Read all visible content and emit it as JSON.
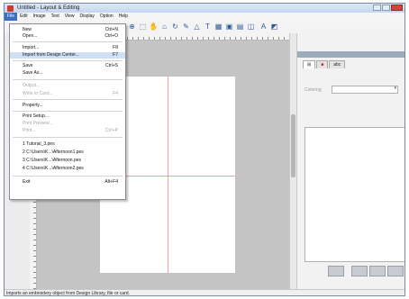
{
  "window": {
    "title": "Untitled - Layout & Editing"
  },
  "menubar": {
    "items": [
      "File",
      "Edit",
      "Image",
      "Text",
      "View",
      "Display",
      "Option",
      "Help"
    ]
  },
  "file_menu": {
    "items": [
      {
        "label": "New",
        "shortcut": "Ctrl+N",
        "enabled": true
      },
      {
        "label": "Open...",
        "shortcut": "Ctrl+O",
        "enabled": true
      },
      {
        "label": "Import...",
        "shortcut": "F8",
        "enabled": true
      },
      {
        "label": "Import from Design Center...",
        "shortcut": "F7",
        "enabled": true,
        "highlighted": true
      },
      {
        "label": "Save",
        "shortcut": "Ctrl+S",
        "enabled": true
      },
      {
        "label": "Save As...",
        "shortcut": "",
        "enabled": true
      },
      {
        "label": "Output...",
        "shortcut": "",
        "enabled": false
      },
      {
        "label": "Write to Card...",
        "shortcut": "F4",
        "enabled": false
      },
      {
        "label": "Property...",
        "shortcut": "",
        "enabled": true
      },
      {
        "label": "Print Setup...",
        "shortcut": "",
        "enabled": true
      },
      {
        "label": "Print Preview...",
        "shortcut": "",
        "enabled": false
      },
      {
        "label": "Print...",
        "shortcut": "Ctrl+P",
        "enabled": false
      },
      {
        "label": "1 Tutorial_3.pes",
        "shortcut": "",
        "enabled": true
      },
      {
        "label": "2 C:\\Users\\K...\\Afternoon1.pes",
        "shortcut": "",
        "enabled": true
      },
      {
        "label": "3 C:\\Users\\K...\\Afternoon.pes",
        "shortcut": "",
        "enabled": true
      },
      {
        "label": "4 C:\\Users\\K...\\Afternoon2.pes",
        "shortcut": "",
        "enabled": true
      },
      {
        "label": "Exit",
        "shortcut": "Alt+F4",
        "enabled": true
      }
    ]
  },
  "sidebar_panel": {
    "tabs": [
      "",
      "",
      "abc"
    ],
    "field": {
      "label": "Coloring",
      "value": ""
    }
  },
  "statusbar": {
    "text": "Imports an embroidery object from Design Library, file or card."
  }
}
